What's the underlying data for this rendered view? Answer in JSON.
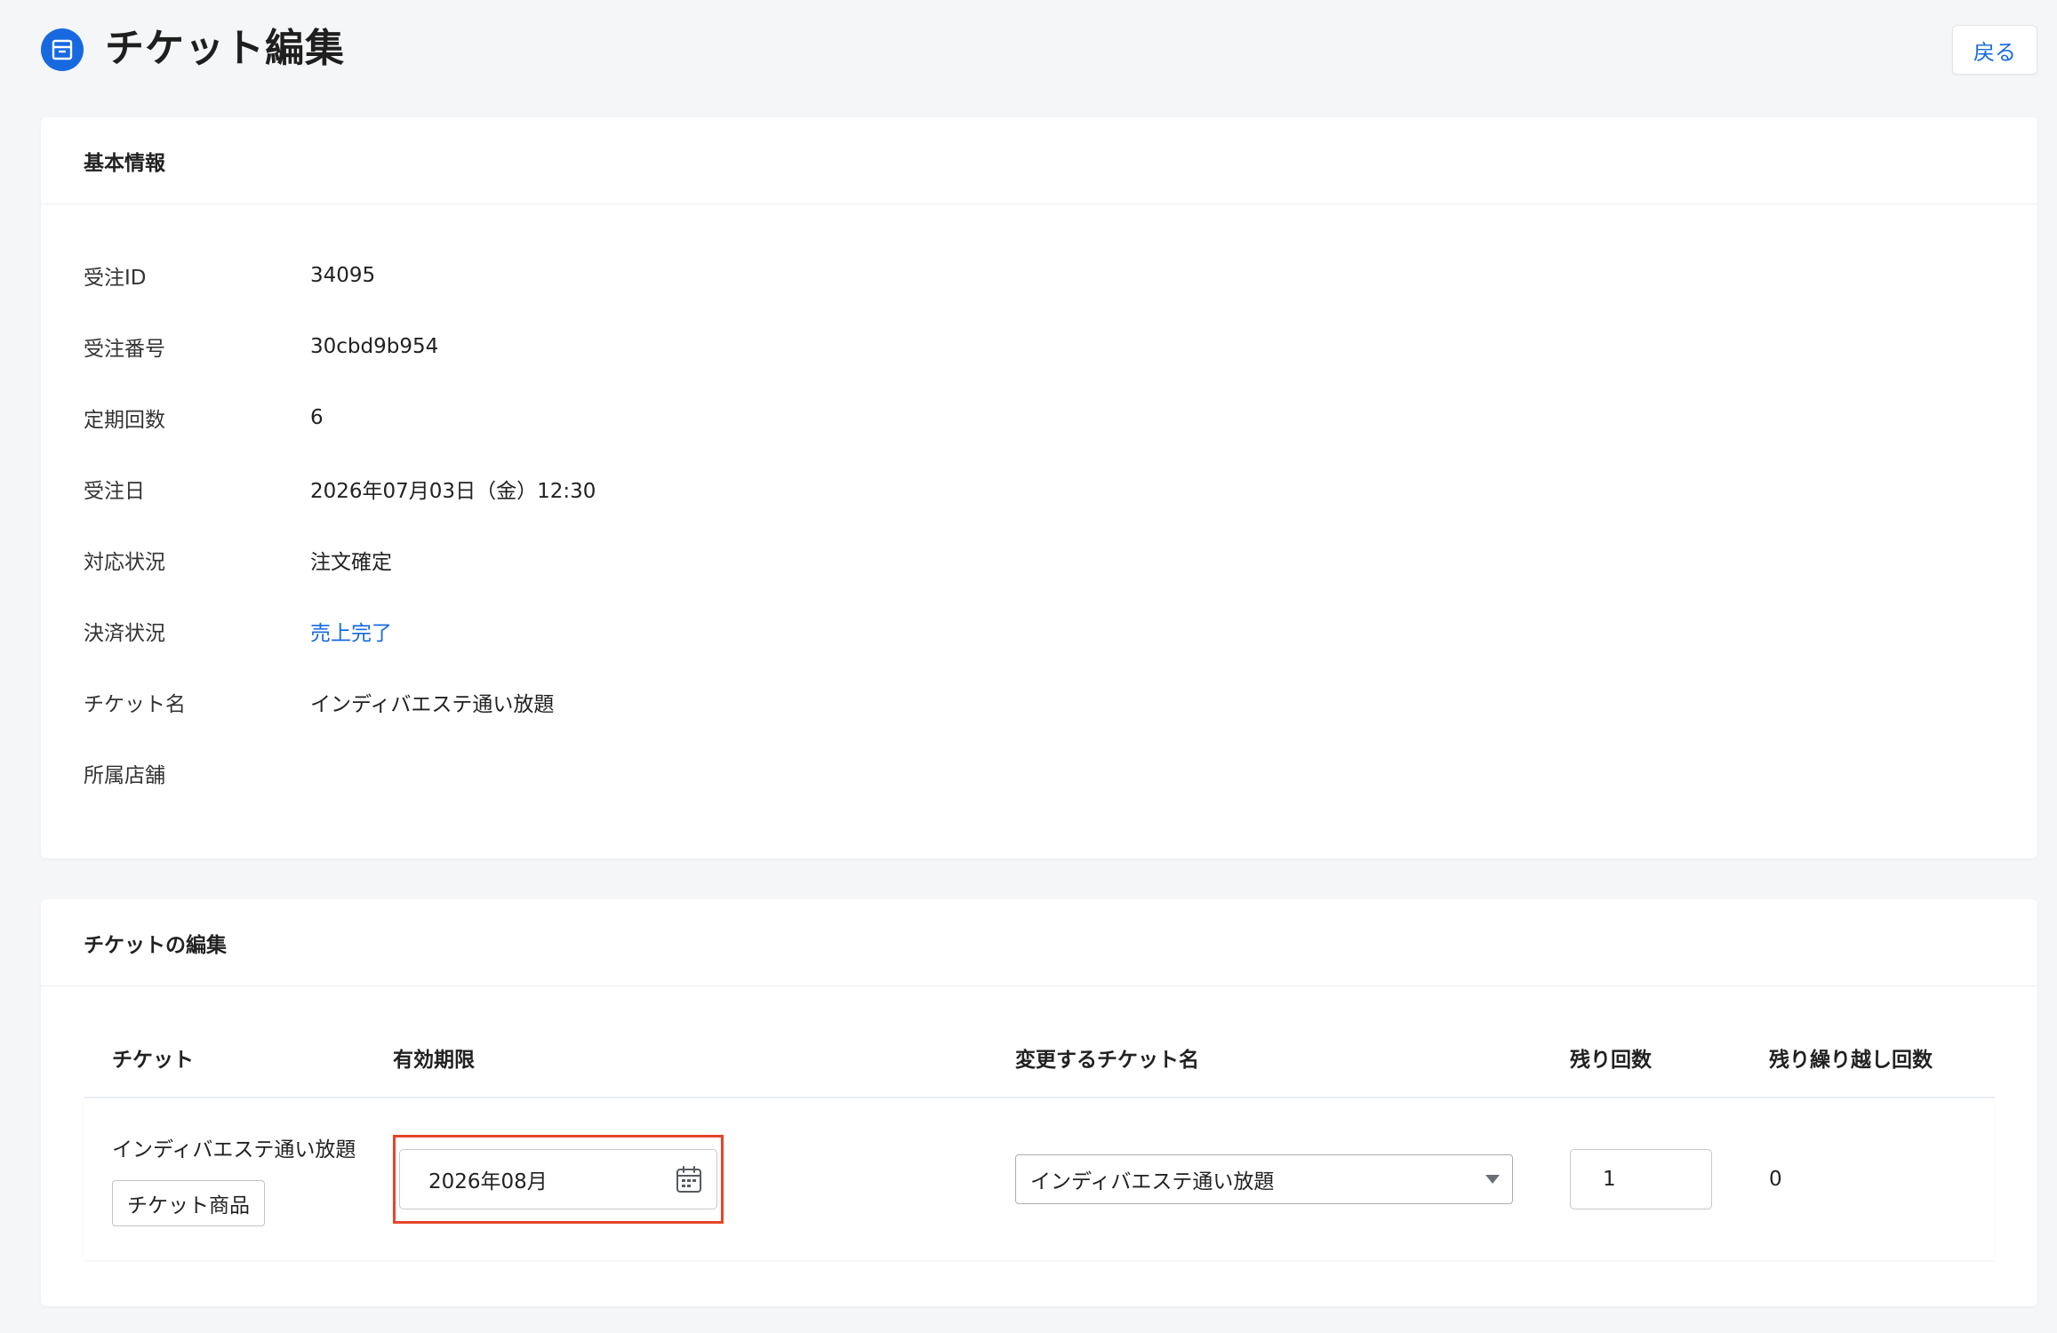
{
  "header": {
    "title": "チケット編集",
    "app_icon": "archive-box-icon",
    "back_label": "戻る"
  },
  "colors": {
    "accent": "#1769e0",
    "highlight_border": "#e6452b",
    "background": "#f5f6f8"
  },
  "basic_info": {
    "section_title": "基本情報",
    "rows": [
      {
        "label": "受注ID",
        "value": "34095"
      },
      {
        "label": "受注番号",
        "value": "30cbd9b954"
      },
      {
        "label": "定期回数",
        "value": "6"
      },
      {
        "label": "受注日",
        "value": "2026年07月03日（金）12:30"
      },
      {
        "label": "対応状況",
        "value": "注文確定"
      },
      {
        "label": "決済状況",
        "value": "売上完了"
      },
      {
        "label": "チケット名",
        "value": "インディバエステ通い放題"
      },
      {
        "label": "所属店舗",
        "value": ""
      }
    ]
  },
  "ticket_edit": {
    "section_title": "チケットの編集",
    "columns": [
      "チケット",
      "有効期限",
      "変更するチケット名",
      "残り回数",
      "残り繰り越し回数"
    ],
    "row": {
      "ticket_name": "インディバエステ通い放題",
      "ticket_tag": "チケット商品",
      "expiry": "2026年08月",
      "expiry_icon": "calendar-icon",
      "new_ticket_name": "インディバエステ通い放題",
      "remaining": "1",
      "carryover": "0"
    }
  }
}
